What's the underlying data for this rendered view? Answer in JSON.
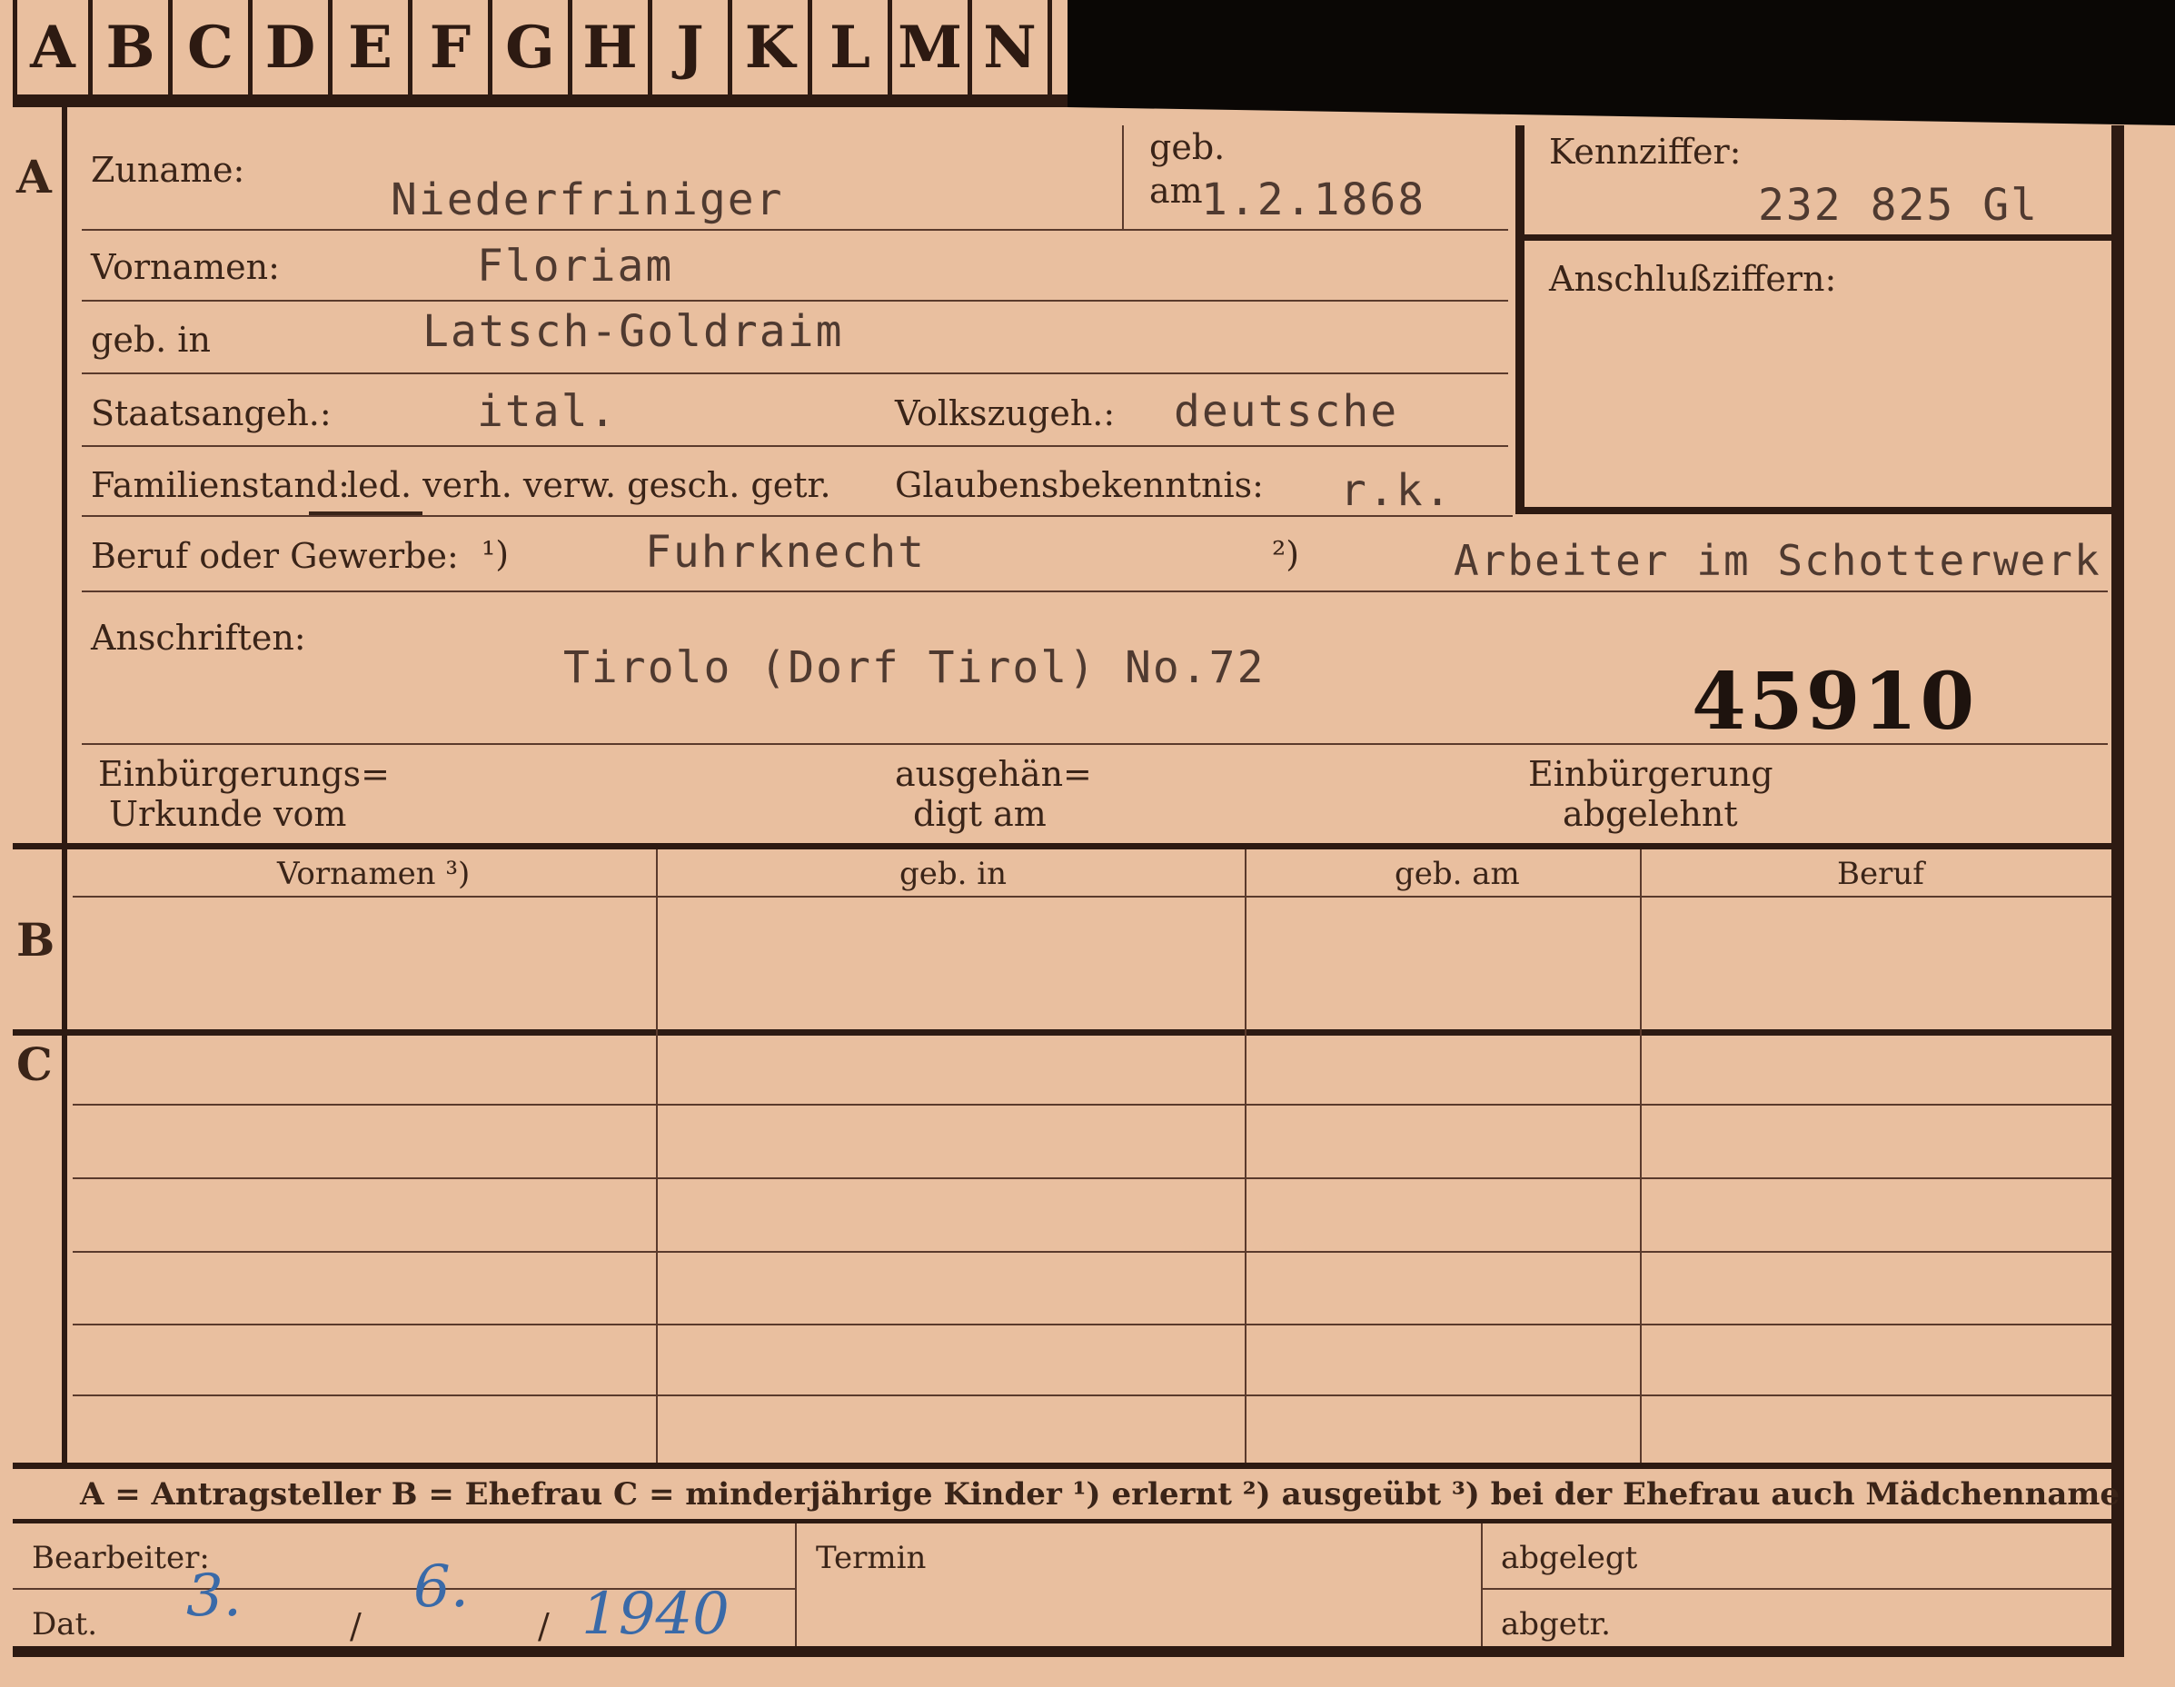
{
  "tabs": [
    "A",
    "B",
    "C",
    "D",
    "E",
    "F",
    "G",
    "H",
    "J",
    "K",
    "L",
    "M",
    "N"
  ],
  "sections": {
    "a": "A",
    "b": "B",
    "c": "C"
  },
  "labels": {
    "zuname": "Zuname:",
    "geb_am_1": "geb.",
    "geb_am_2": "am",
    "kennziffer": "Kennziffer:",
    "anschluss": "Anschlußziffern:",
    "vornamen": "Vornamen:",
    "geb_in": "geb. in",
    "staatsangeh": "Staatsangeh.:",
    "volkszugeh": "Volkszugeh.:",
    "familienstand": "Familienstand:",
    "fam_options": "led. verh. verw. gesch. getr.",
    "glaubens": "Glaubensbekenntnis:",
    "beruf": "Beruf oder Gewerbe:",
    "note1": "¹)",
    "note2": "²)",
    "anschriften": "Anschriften:",
    "einb_urkunde_1": "Einbürgerungs=",
    "einb_urkunde_2": "Urkunde vom",
    "ausgeh_1": "ausgehän=",
    "ausgeh_2": "digt am",
    "einb_abgel_1": "Einbürgerung",
    "einb_abgel_2": "abgelehnt",
    "col_vornamen": "Vornamen ³)",
    "col_geb_in": "geb. in",
    "col_geb_am": "geb. am",
    "col_beruf": "Beruf",
    "legend": "A = Antragsteller   B = Ehefrau   C = minderjährige Kinder   ¹) erlernt   ²) ausgeübt   ³) bei der Ehefrau auch Mädchenname",
    "bearbeiter": "Bearbeiter:",
    "dat": "Dat.",
    "termin": "Termin",
    "abgelegt": "abgelegt",
    "abgetr": "abgetr."
  },
  "values": {
    "zuname": "Niederfriniger",
    "geb_am": "1.2.1868",
    "kennziffer": "232 825    Gl",
    "vornamen": "Floriam",
    "geb_in": "Latsch-Goldraim",
    "staatsangeh": "ital.",
    "volkszugeh": "deutsche",
    "glaubens": "r.k.",
    "beruf_erlernt": "Fuhrknecht",
    "beruf_ausgeuebt": "Arbeiter im Schotterwerk",
    "anschrift": "Tirolo (Dorf Tirol) No.72",
    "number": "45910",
    "date_day": "3.",
    "date_month": "6.",
    "date_year": "1940"
  }
}
